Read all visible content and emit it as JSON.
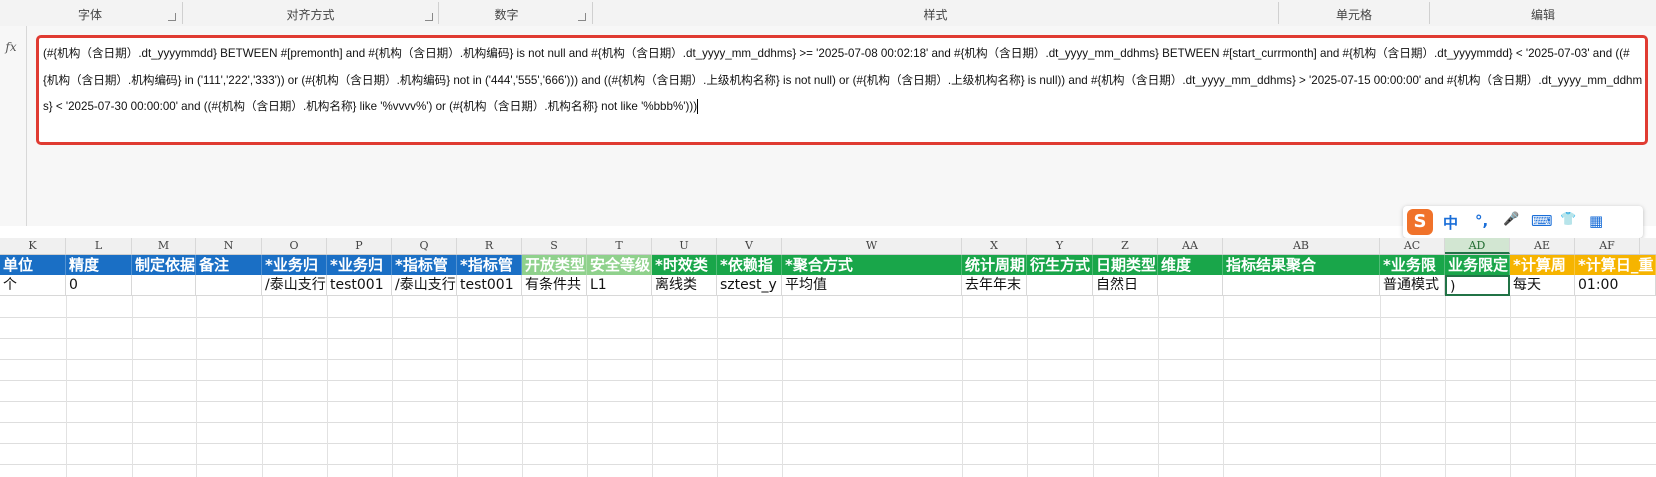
{
  "ribbon": {
    "groups": [
      {
        "label": "字体"
      },
      {
        "label": "对齐方式"
      },
      {
        "label": "数字"
      },
      {
        "label": "样式"
      },
      {
        "label": "单元格"
      },
      {
        "label": "编辑"
      }
    ]
  },
  "formula_bar": {
    "fx_label": "fx",
    "text": "(#{机构（含日期）.dt_yyyymmdd} BETWEEN #[premonth] and #{机构（含日期）.机构编码} is not null and #{机构（含日期）.dt_yyyy_mm_ddhms} >= '2025-07-08 00:02:18' and #{机构（含日期）.dt_yyyy_mm_ddhms} BETWEEN #[start_currmonth] and #{机构（含日期）.dt_yyyymmdd} < '2025-07-03' and ((#{机构（含日期）.机构编码} in ('111','222','333')) or (#{机构（含日期）.机构编码} not in ('444','555','666'))) and ((#{机构（含日期）.上级机构名称} is not null) or (#{机构（含日期）.上级机构名称} is null)) and #{机构（含日期）.dt_yyyy_mm_ddhms} > '2025-07-15 00:00:00' and #{机构（含日期）.dt_yyyy_mm_ddhms} < '2025-07-30 00:00:00' and ((#{机构（含日期）.机构名称} like '%vvvv%') or (#{机构（含日期）.机构名称} not like '%bbb%')))"
  },
  "ime_toolbar": {
    "logo": "S",
    "items": [
      "中",
      "°,",
      "🎤",
      "⌨",
      "👕",
      "▦"
    ]
  },
  "columns": [
    "K",
    "L",
    "M",
    "N",
    "O",
    "P",
    "Q",
    "R",
    "S",
    "T",
    "U",
    "V",
    "W",
    "X",
    "Y",
    "Z",
    "AA",
    "AB",
    "AC",
    "AD",
    "AE",
    "AF"
  ],
  "selected_column": "AD",
  "header_row": [
    "单位",
    "精度",
    "制定依据",
    "备注",
    "*业务归",
    "*业务归",
    "*指标管",
    "*指标管",
    "开放类型",
    "安全等级",
    "*时效类",
    "*依赖指",
    "*聚合方式",
    "统计周期",
    "衍生方式",
    "日期类型",
    "维度",
    "指标结果聚合",
    "*业务限",
    "业务限定",
    "*计算周",
    "*计算日_重"
  ],
  "data_row": [
    "个",
    "0",
    "",
    "",
    "/泰山支行",
    "test001",
    "/泰山支行",
    "test001",
    "有条件共",
    "L1",
    "离线类",
    "sztest_y",
    "平均值",
    "去年年末",
    "",
    "自然日",
    "",
    "",
    "普通模式",
    ")",
    "每天",
    "01:00"
  ],
  "colors": {
    "blue": "#1a6fc5",
    "green": "#19a64a",
    "light_green": "#8fd18c",
    "orange": "#f6b400",
    "formula_border": "#e03b32",
    "selection": "#217346"
  }
}
